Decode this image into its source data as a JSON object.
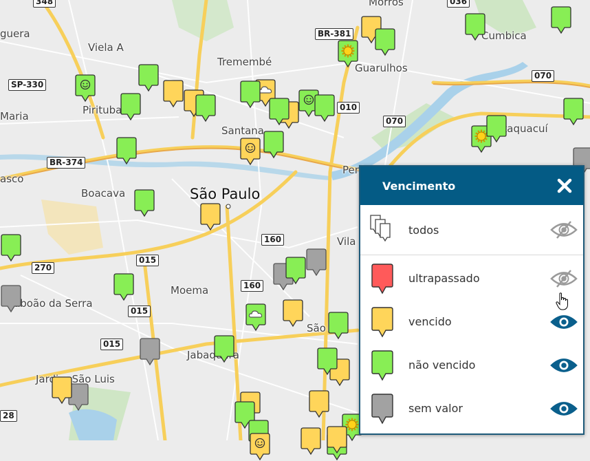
{
  "map": {
    "places": [
      {
        "text": "guera",
        "cls": ""
      },
      {
        "text": "Viela A",
        "cls": ""
      },
      {
        "text": "Tremembé",
        "cls": ""
      },
      {
        "text": "Guarulhos",
        "cls": ""
      },
      {
        "text": "Morros",
        "cls": ""
      },
      {
        "text": "Cumbica",
        "cls": ""
      },
      {
        "text": "Pirituba",
        "cls": ""
      },
      {
        "text": "Maria",
        "cls": ""
      },
      {
        "text": "Santana",
        "cls": ""
      },
      {
        "text": "Itaquacuí",
        "cls": ""
      },
      {
        "text": "asco",
        "cls": ""
      },
      {
        "text": "Boacava",
        "cls": ""
      },
      {
        "text": "São Paulo",
        "cls": "city"
      },
      {
        "text": "Penha",
        "cls": ""
      },
      {
        "text": "Vila",
        "cls": ""
      },
      {
        "text": "Moema",
        "cls": ""
      },
      {
        "text": "aboão da Serra",
        "cls": ""
      },
      {
        "text": "São",
        "cls": ""
      },
      {
        "text": "Jabaquara",
        "cls": ""
      },
      {
        "text": "Jardim São Luis",
        "cls": ""
      }
    ],
    "shields": [
      "348",
      "036",
      "BR-381",
      "SP-330",
      "010",
      "070",
      "070",
      "BR-374",
      "015",
      "160",
      "270",
      "160",
      "015",
      "015",
      "28"
    ],
    "pin_colors": {
      "green": "#88ee55",
      "yellow": "#ffd55a",
      "gray": "#a2a2a2",
      "red": "#ff5a5a"
    },
    "pins": [
      {
        "color": "yellow",
        "icon": ""
      },
      {
        "color": "green",
        "icon": ""
      },
      {
        "color": "green",
        "icon": ""
      },
      {
        "color": "green",
        "icon": ""
      },
      {
        "color": "green",
        "icon": "sun"
      },
      {
        "color": "green",
        "icon": "smile"
      },
      {
        "color": "green",
        "icon": ""
      },
      {
        "color": "yellow",
        "icon": ""
      },
      {
        "color": "green",
        "icon": ""
      },
      {
        "color": "yellow",
        "icon": ""
      },
      {
        "color": "green",
        "icon": ""
      },
      {
        "color": "yellow",
        "icon": "cloud"
      },
      {
        "color": "green",
        "icon": ""
      },
      {
        "color": "yellow",
        "icon": ""
      },
      {
        "color": "green",
        "icon": "smile"
      },
      {
        "color": "green",
        "icon": ""
      },
      {
        "color": "green",
        "icon": ""
      },
      {
        "color": "green",
        "icon": ""
      },
      {
        "color": "green",
        "icon": "sun"
      },
      {
        "color": "green",
        "icon": ""
      },
      {
        "color": "yellow",
        "icon": "smile"
      },
      {
        "color": "green",
        "icon": ""
      },
      {
        "color": "gray",
        "icon": ""
      },
      {
        "color": "green",
        "icon": ""
      },
      {
        "color": "yellow",
        "icon": ""
      },
      {
        "color": "green",
        "icon": ""
      },
      {
        "color": "green",
        "icon": ""
      },
      {
        "color": "gray",
        "icon": ""
      },
      {
        "color": "gray",
        "icon": ""
      },
      {
        "color": "gray",
        "icon": ""
      },
      {
        "color": "green",
        "icon": ""
      },
      {
        "color": "yellow",
        "icon": ""
      },
      {
        "color": "green",
        "icon": "cloud"
      },
      {
        "color": "green",
        "icon": ""
      },
      {
        "color": "green",
        "icon": ""
      },
      {
        "color": "gray",
        "icon": ""
      },
      {
        "color": "green",
        "icon": ""
      },
      {
        "color": "yellow",
        "icon": ""
      },
      {
        "color": "gray",
        "icon": ""
      },
      {
        "color": "yellow",
        "icon": ""
      },
      {
        "color": "green",
        "icon": ""
      },
      {
        "color": "yellow",
        "icon": ""
      },
      {
        "color": "yellow",
        "icon": ""
      },
      {
        "color": "green",
        "icon": ""
      },
      {
        "color": "yellow",
        "icon": ""
      },
      {
        "color": "green",
        "icon": "sun"
      },
      {
        "color": "green",
        "icon": ""
      },
      {
        "color": "yellow",
        "icon": ""
      },
      {
        "color": "green",
        "icon": ""
      },
      {
        "color": "yellow",
        "icon": "smile"
      }
    ]
  },
  "legend": {
    "title": "Vencimento",
    "close_icon": "close-icon",
    "items": [
      {
        "label": "todos",
        "color": "#ffffff",
        "visible": false,
        "kind": "all"
      },
      {
        "label": "ultrapassado",
        "color": "#ff5a5a",
        "visible": false
      },
      {
        "label": "vencido",
        "color": "#ffd55a",
        "visible": true
      },
      {
        "label": "não vencido",
        "color": "#88ee55",
        "visible": true
      },
      {
        "label": "sem valor",
        "color": "#a2a2a2",
        "visible": true
      }
    ],
    "eye_color_on": "#0a5f8c",
    "eye_color_off": "#9a9a9a"
  }
}
